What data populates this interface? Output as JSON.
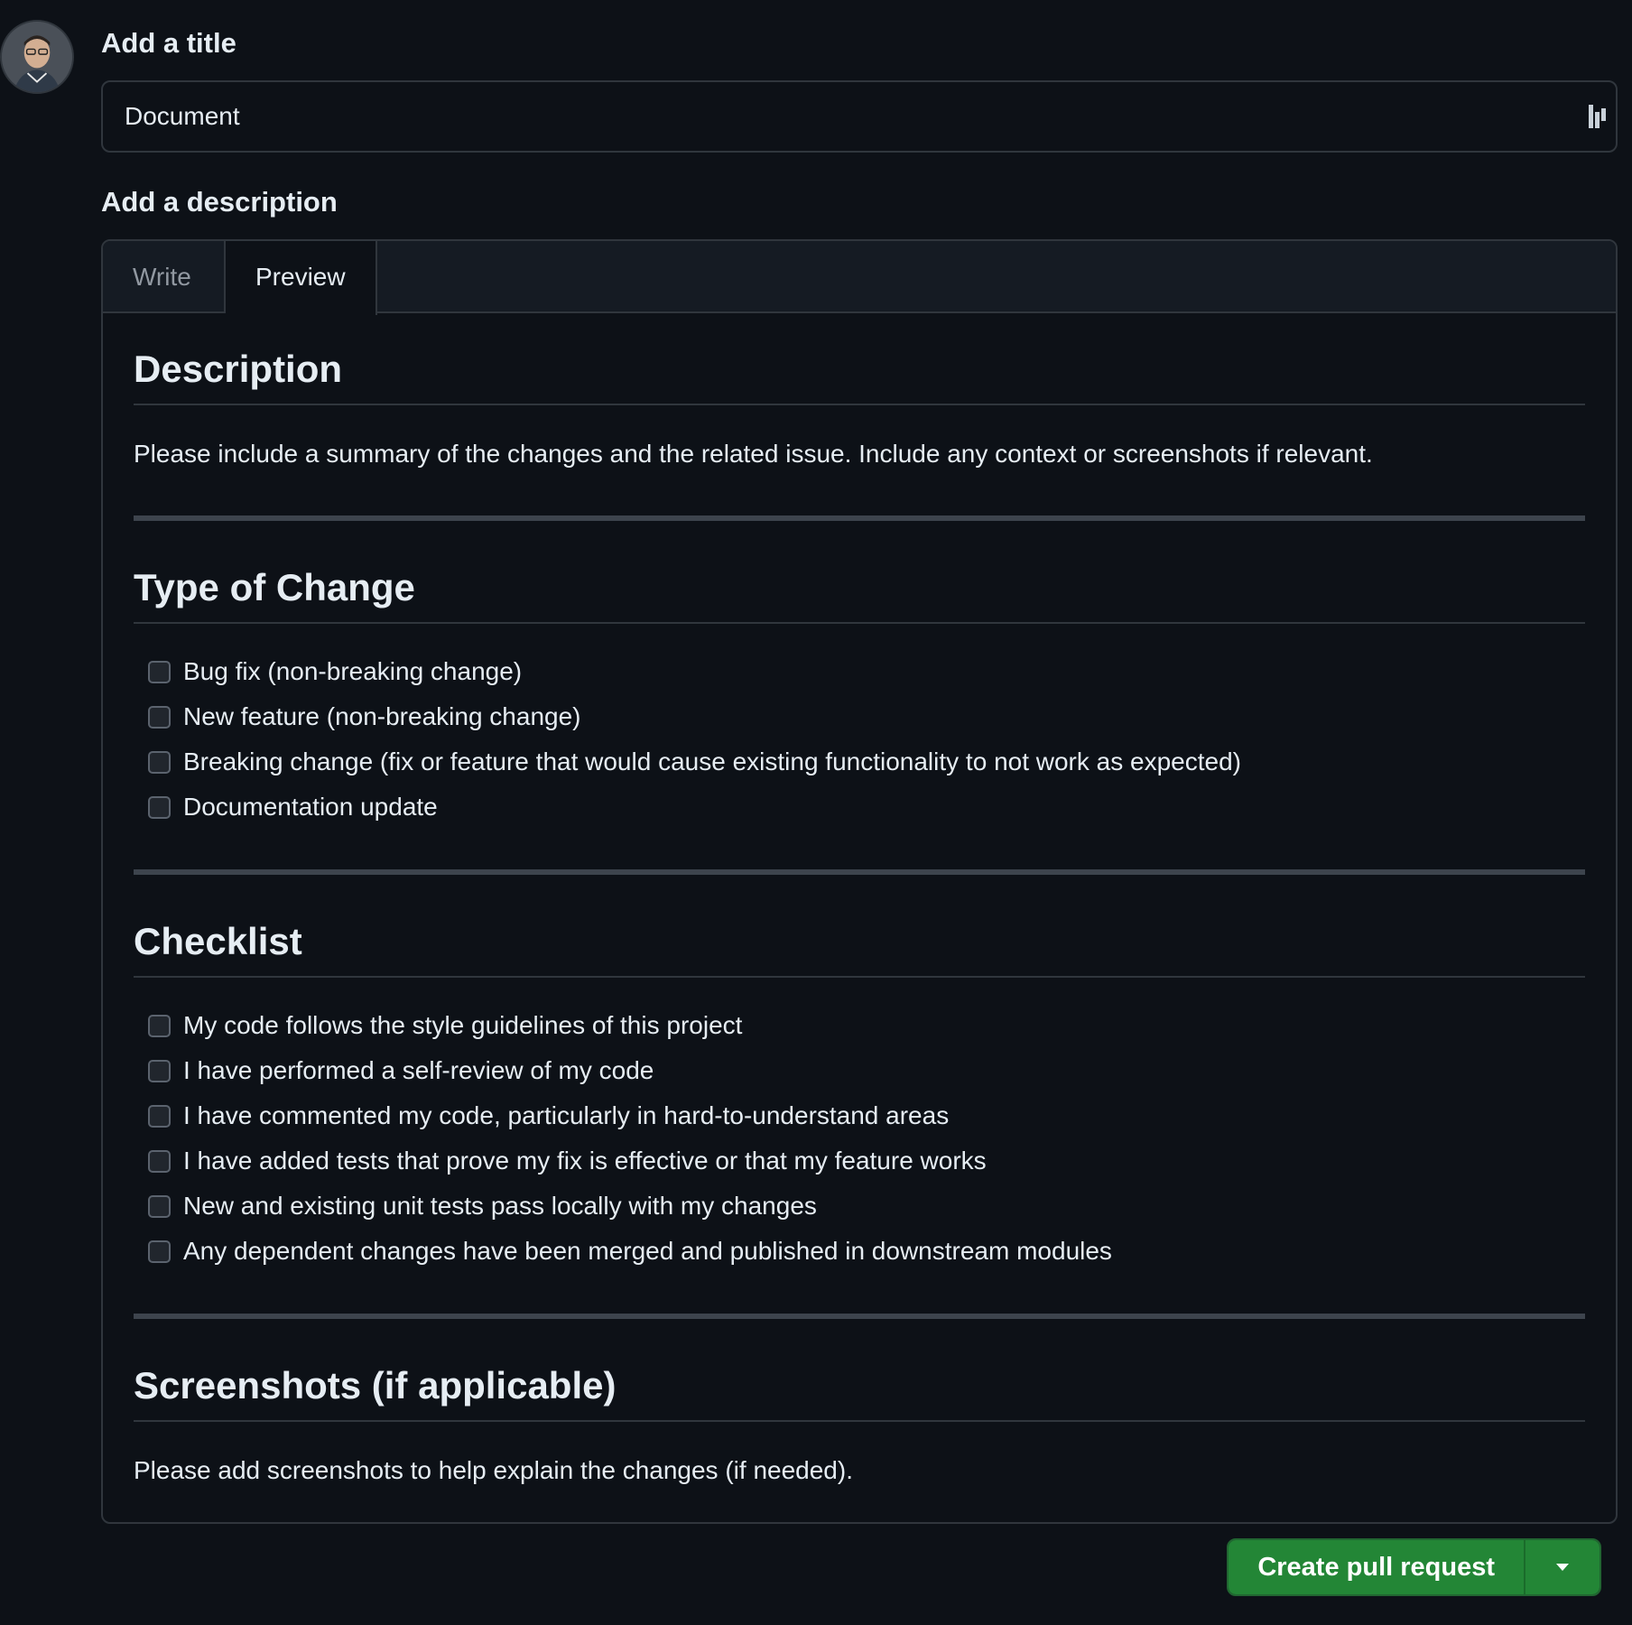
{
  "title_section": {
    "label": "Add a title",
    "value": "Document"
  },
  "description_section": {
    "label": "Add a description",
    "tabs": [
      {
        "label": "Write",
        "active": false
      },
      {
        "label": "Preview",
        "active": true
      }
    ]
  },
  "preview": {
    "description": {
      "heading": "Description",
      "text": "Please include a summary of the changes and the related issue. Include any context or screenshots if relevant."
    },
    "type_of_change": {
      "heading": "Type of Change",
      "items": [
        "Bug fix (non-breaking change)",
        "New feature (non-breaking change)",
        "Breaking change (fix or feature that would cause existing functionality to not work as expected)",
        "Documentation update"
      ]
    },
    "checklist": {
      "heading": "Checklist",
      "items": [
        "My code follows the style guidelines of this project",
        "I have performed a self-review of my code",
        "I have commented my code, particularly in hard-to-understand areas",
        "I have added tests that prove my fix is effective or that my feature works",
        "New and existing unit tests pass locally with my changes",
        "Any dependent changes have been merged and published in downstream modules"
      ]
    },
    "screenshots": {
      "heading": "Screenshots (if applicable)",
      "text": "Please add screenshots to help explain the changes (if needed)."
    }
  },
  "actions": {
    "create_label": "Create pull request"
  },
  "colors": {
    "background": "#0d1117",
    "border": "#30363d",
    "primary_button": "#238636",
    "text": "#e6edf3",
    "muted_text": "#9198a1"
  },
  "icons": {
    "avatar": "user-avatar",
    "title_extension": "extension-icon",
    "dropdown": "triangle-down-icon"
  }
}
